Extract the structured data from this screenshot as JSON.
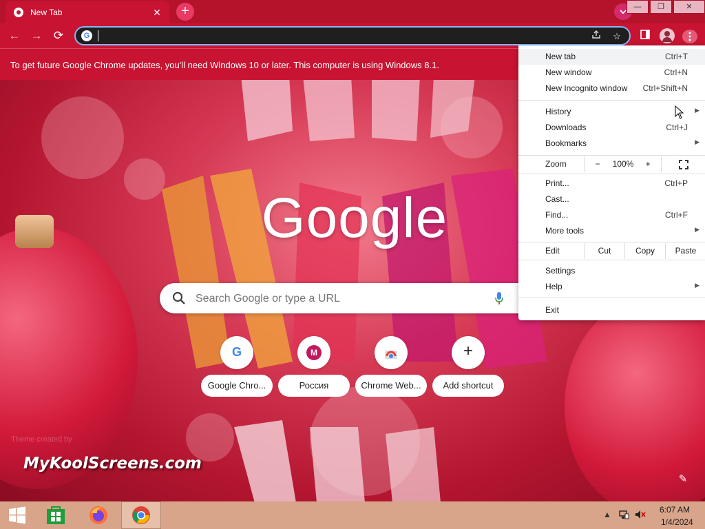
{
  "tab": {
    "title": "New Tab",
    "close": "✕"
  },
  "newtab_symbol": "+",
  "window_controls": [
    "—",
    "❐",
    "✕"
  ],
  "toolbar": {
    "back": "←",
    "forward": "→",
    "reload": "⟳",
    "omnibox_value": ""
  },
  "infobar": {
    "message": "To get future Google Chrome updates, you'll need Windows 10 or later. This computer is using Windows 8.1."
  },
  "ntp": {
    "logo_text": "Google",
    "search_placeholder": "Search Google or type a URL",
    "shortcuts": [
      {
        "label": "Google Chro..."
      },
      {
        "label": "Россия",
        "initial": "M"
      },
      {
        "label": "Chrome Web..."
      },
      {
        "label": "Add shortcut"
      }
    ],
    "theme_credit": "Theme created by",
    "watermark": "MyKoolScreens.com"
  },
  "menu": {
    "new_tab": {
      "label": "New tab",
      "shortcut": "Ctrl+T"
    },
    "new_window": {
      "label": "New window",
      "shortcut": "Ctrl+N"
    },
    "incognito": {
      "label": "New Incognito window",
      "shortcut": "Ctrl+Shift+N"
    },
    "history": {
      "label": "History"
    },
    "downloads": {
      "label": "Downloads",
      "shortcut": "Ctrl+J"
    },
    "bookmarks": {
      "label": "Bookmarks"
    },
    "zoom": {
      "label": "Zoom",
      "minus": "−",
      "value": "100%",
      "plus": "+"
    },
    "print": {
      "label": "Print...",
      "shortcut": "Ctrl+P"
    },
    "cast": {
      "label": "Cast..."
    },
    "find": {
      "label": "Find...",
      "shortcut": "Ctrl+F"
    },
    "more_tools": {
      "label": "More tools"
    },
    "edit": {
      "label": "Edit",
      "cut": "Cut",
      "copy": "Copy",
      "paste": "Paste"
    },
    "settings": {
      "label": "Settings"
    },
    "help": {
      "label": "Help"
    },
    "exit": {
      "label": "Exit"
    }
  },
  "taskbar": {
    "time": "6:07 AM",
    "date": "1/4/2024"
  },
  "colors": {
    "accent": "#c81432",
    "menu_bg": "#ffffff",
    "taskbar": "#d8a48a"
  }
}
